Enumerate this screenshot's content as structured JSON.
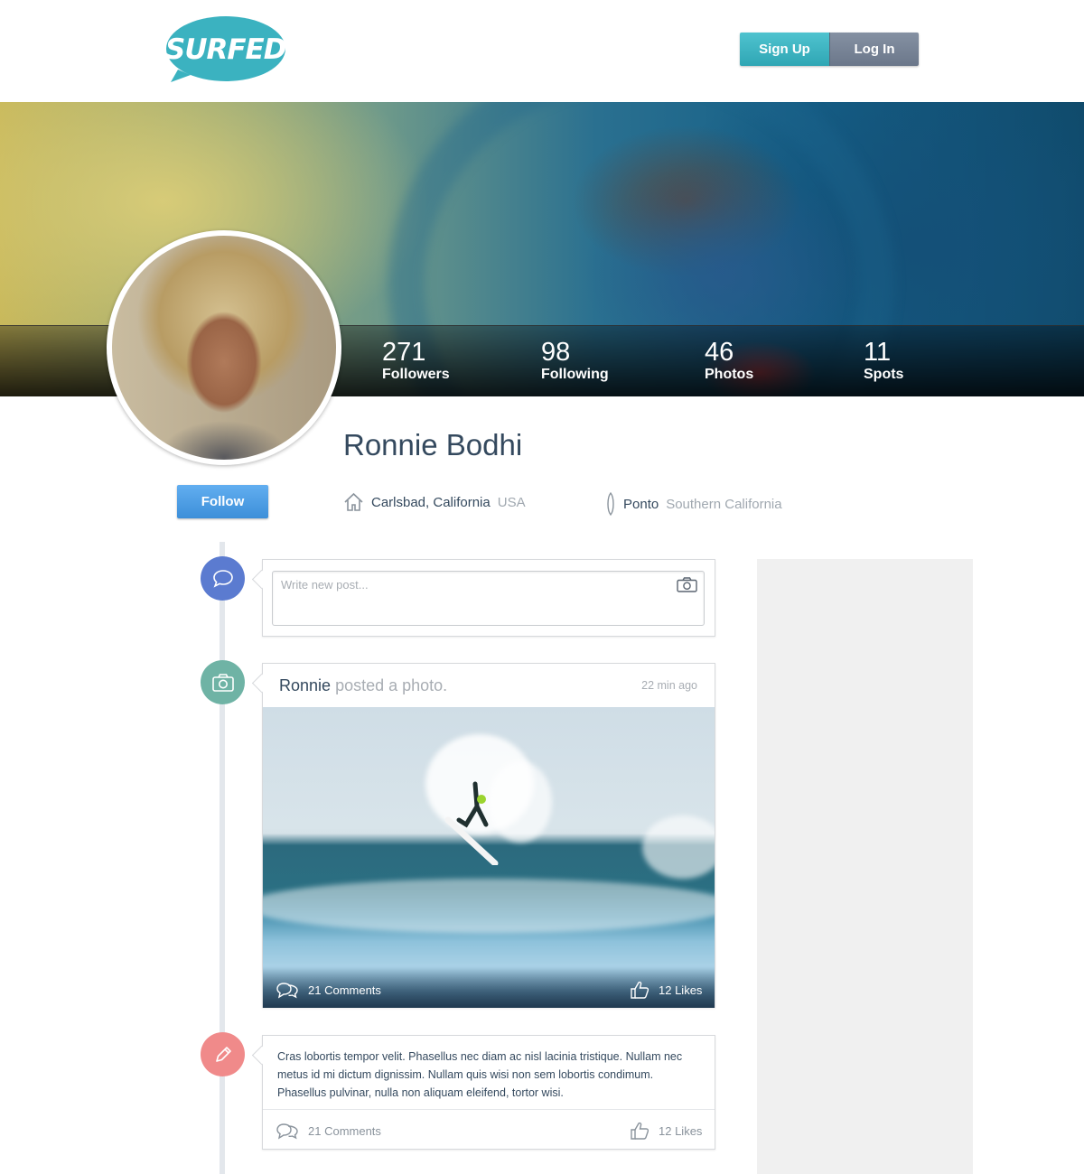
{
  "header": {
    "logo_text": "SURFED.it",
    "signup_label": "Sign Up",
    "login_label": "Log In"
  },
  "colors": {
    "brand_teal": "#3bb2c0",
    "follow_blue": "#4a9be3",
    "comment_icon_bg": "#5b7bd0",
    "photo_icon_bg": "#6fb3a5",
    "text_icon_bg": "#f08a8a"
  },
  "stats": [
    {
      "value": "271",
      "label": "Followers"
    },
    {
      "value": "98",
      "label": "Following"
    },
    {
      "value": "46",
      "label": "Photos"
    },
    {
      "value": "11",
      "label": "Spots"
    }
  ],
  "profile": {
    "name": "Ronnie Bodhi",
    "follow_label": "Follow",
    "home_city": "Carlsbad, California",
    "home_country": "USA",
    "spot_name": "Ponto",
    "spot_region": "Southern California",
    "home_icon": "house-icon",
    "spot_icon": "surfboard-icon"
  },
  "composer": {
    "placeholder": "Write new post...",
    "icon": "chat-bubble-icon"
  },
  "posts": [
    {
      "type": "photo",
      "icon": "camera-icon",
      "user": "Ronnie",
      "action": "posted a photo.",
      "time": "22 min ago",
      "comments": "21 Comments",
      "likes": "12 Likes"
    },
    {
      "type": "text",
      "icon": "pencil-icon",
      "body": "Cras lobortis tempor velit. Phasellus nec diam ac nisl lacinia tristique. Nullam nec metus id mi dictum dignissim. Nullam quis wisi non sem lobortis condimum. Phasellus pulvinar, nulla non aliquam eleifend, tortor wisi.",
      "comments": "21 Comments",
      "likes": "12 Likes"
    }
  ]
}
